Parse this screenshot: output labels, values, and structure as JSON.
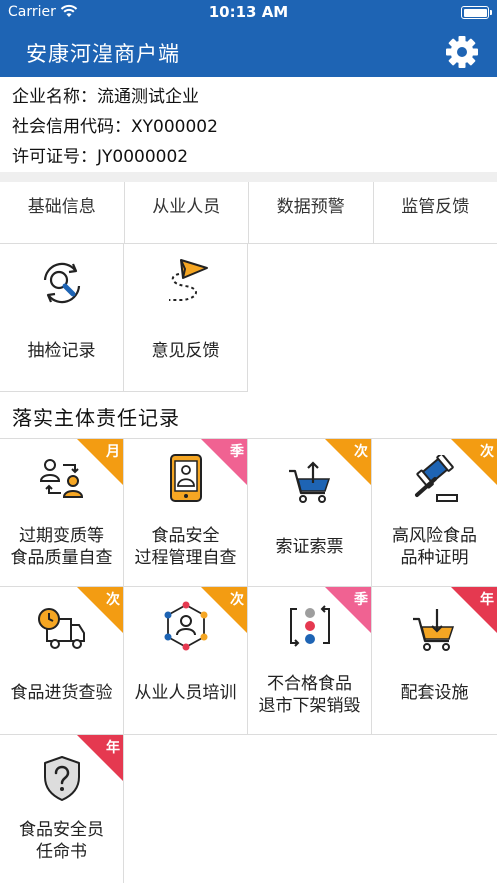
{
  "status_bar": {
    "carrier": "Carrier",
    "time": "10:13 AM"
  },
  "nav": {
    "title": "安康河湟商户端",
    "settings_icon": "gear-icon"
  },
  "company": {
    "name_label": "企业名称：",
    "name_value": "流通测试企业",
    "credit_label": "社会信用代码：",
    "credit_value": "XY000002",
    "license_label": "许可证号：",
    "license_value": "JY0000002"
  },
  "tabs": [
    "基础信息",
    "从业人员",
    "数据预警",
    "监管反馈"
  ],
  "quick_items": [
    {
      "label": "抽检记录",
      "icon": "magnifier-refresh-icon"
    },
    {
      "label": "意见反馈",
      "icon": "paper-plane-icon"
    }
  ],
  "section_title": "落实主体责任记录",
  "colors": {
    "primary": "#1e64b4",
    "badge_orange": "#f39c12",
    "badge_pink": "#f06292",
    "badge_red": "#e53950"
  },
  "records": [
    {
      "label": "过期变质等\n食品质量自查",
      "badge": "月",
      "badge_color": "#f39c12",
      "icon": "people-exchange-icon"
    },
    {
      "label": "食品安全\n过程管理自查",
      "badge": "季",
      "badge_color": "#f06292",
      "icon": "phone-person-icon"
    },
    {
      "label": "索证索票",
      "badge": "次",
      "badge_color": "#f39c12",
      "icon": "cart-upload-icon"
    },
    {
      "label": "高风险食品\n品种证明",
      "badge": "次",
      "badge_color": "#f39c12",
      "icon": "gavel-icon"
    },
    {
      "label": "食品进货查验",
      "badge": "次",
      "badge_color": "#f39c12",
      "icon": "delivery-truck-icon"
    },
    {
      "label": "从业人员培训",
      "badge": "次",
      "badge_color": "#f39c12",
      "icon": "people-network-icon"
    },
    {
      "label": "不合格食品\n退市下架销毁",
      "badge": "季",
      "badge_color": "#f06292",
      "icon": "recycle-flow-icon"
    },
    {
      "label": "配套设施",
      "badge": "年",
      "badge_color": "#e53950",
      "icon": "cart-download-icon"
    },
    {
      "label": "食品安全员\n任命书",
      "badge": "年",
      "badge_color": "#e53950",
      "icon": "shield-question-icon"
    }
  ]
}
